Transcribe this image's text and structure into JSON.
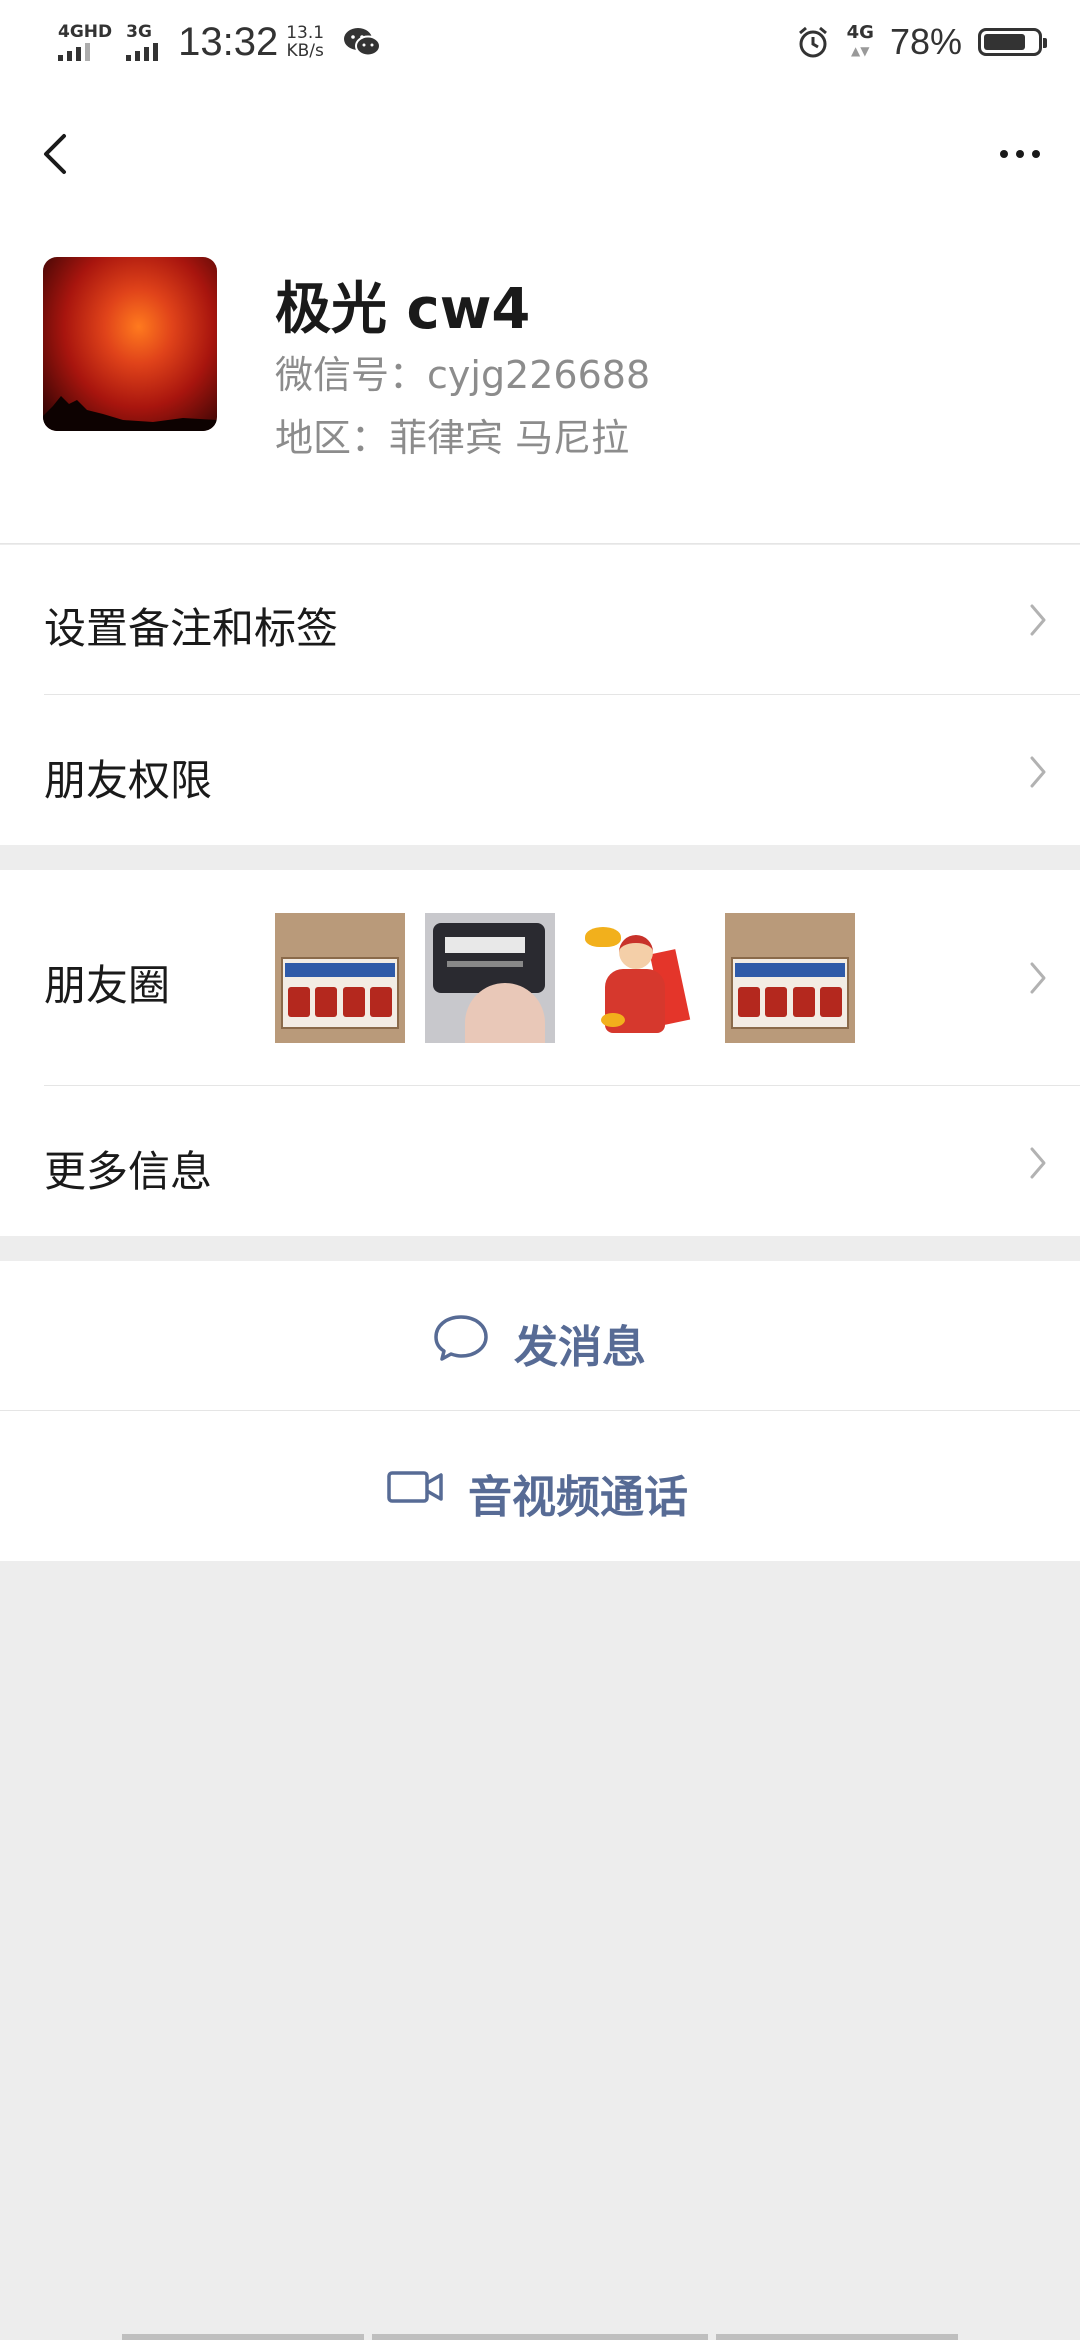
{
  "status_bar": {
    "net1_label": "4GHD",
    "net2_label": "3G",
    "time": "13:32",
    "speed_value": "13.1",
    "speed_unit": "KB/s",
    "net_right_label": "4G",
    "battery_percent": "78%",
    "battery_level": 0.78,
    "icons": [
      "signal-icon",
      "wechat-icon",
      "alarm-icon",
      "battery-icon"
    ]
  },
  "nav": {
    "back_icon": "chevron-left-icon",
    "more_icon": "more-dots-icon"
  },
  "profile": {
    "name": "极光 cw4",
    "wechat_id": "微信号：cyjg226688",
    "region": "地区：菲律宾  马尼拉"
  },
  "menu": {
    "remark_tags": "设置备注和标签",
    "friend_permissions": "朋友权限",
    "moments": "朋友圈",
    "more_info": "更多信息"
  },
  "actions": {
    "send_message": "发消息",
    "video_call": "音视频通话"
  },
  "colors": {
    "accent_link": "#576b95",
    "background": "#ededed",
    "cell": "#ffffff"
  }
}
